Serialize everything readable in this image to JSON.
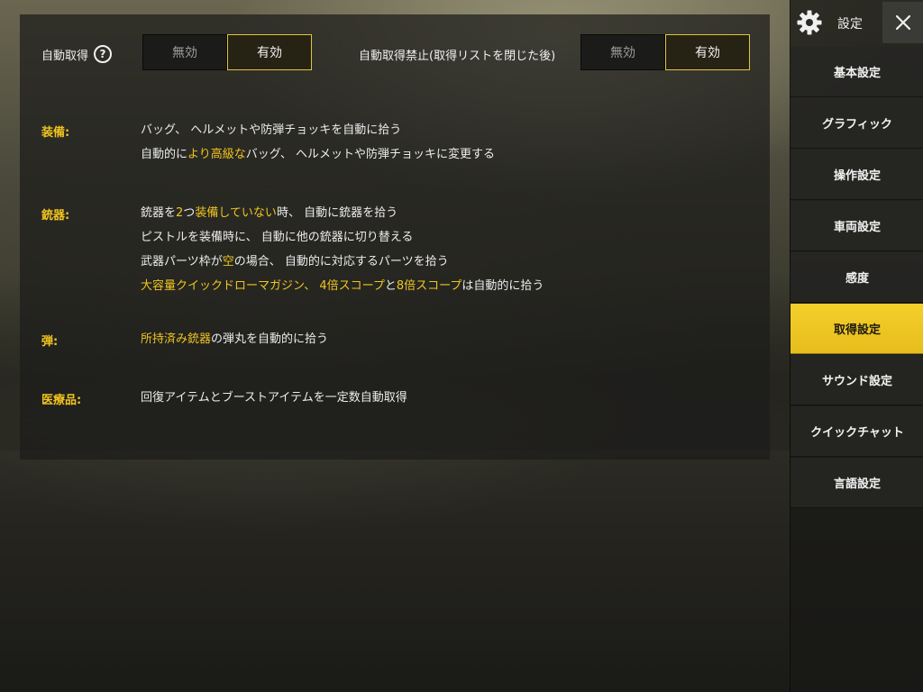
{
  "header": {
    "settings_title": "設定"
  },
  "auto_pickup": {
    "label": "自動取得",
    "off_label": "無効",
    "on_label": "有効",
    "selected": "有効"
  },
  "auto_pickup_ban": {
    "label": "自動取得禁止(取得リストを閉じた後)",
    "off_label": "無効",
    "on_label": "有効",
    "selected": "有効"
  },
  "sections": [
    {
      "head": "装備:",
      "lines": [
        [
          {
            "t": "バッグ、 ヘルメットや防弾チョッキを自動に拾う",
            "hl": false
          }
        ],
        [
          {
            "t": "自動的に",
            "hl": false
          },
          {
            "t": "より高級な",
            "hl": true
          },
          {
            "t": "バッグ、 ヘルメットや防弾チョッキに変更する",
            "hl": false
          }
        ]
      ]
    },
    {
      "head": "銃器:",
      "lines": [
        [
          {
            "t": "銃器を",
            "hl": false
          },
          {
            "t": "2",
            "hl": true
          },
          {
            "t": "つ",
            "hl": false
          },
          {
            "t": "装備していない",
            "hl": true
          },
          {
            "t": "時、 自動に銃器を拾う",
            "hl": false
          }
        ],
        [
          {
            "t": "ピストルを装備時に、 自動に他の銃器に切り替える",
            "hl": false
          }
        ],
        [
          {
            "t": "武器パーツ枠が",
            "hl": false
          },
          {
            "t": "空",
            "hl": true
          },
          {
            "t": "の場合、 自動的に対応するパーツを拾う",
            "hl": false
          }
        ],
        [
          {
            "t": "大容量クイックドローマガジン、 4倍スコープ",
            "hl": true
          },
          {
            "t": "と",
            "hl": false
          },
          {
            "t": "8倍スコープ",
            "hl": true
          },
          {
            "t": "は自動的に拾う",
            "hl": false
          }
        ]
      ]
    },
    {
      "head": "弾:",
      "lines": [
        [
          {
            "t": "所持済み銃器",
            "hl": true
          },
          {
            "t": "の弾丸を自動的に拾う",
            "hl": false
          }
        ]
      ]
    },
    {
      "head": "医療品:",
      "lines": [
        [
          {
            "t": "回復アイテムとブーストアイテムを一定数自動取得",
            "hl": false
          }
        ]
      ]
    }
  ],
  "sidebar": {
    "items": [
      {
        "label": "基本設定",
        "active": false
      },
      {
        "label": "グラフィック",
        "active": false
      },
      {
        "label": "操作設定",
        "active": false
      },
      {
        "label": "車両設定",
        "active": false
      },
      {
        "label": "感度",
        "active": false
      },
      {
        "label": "取得設定",
        "active": true
      },
      {
        "label": "サウンド設定",
        "active": false
      },
      {
        "label": "クイックチャット",
        "active": false
      },
      {
        "label": "言語設定",
        "active": false
      }
    ]
  },
  "colors": {
    "accent": "#f0c520",
    "active_tab": "#f4cf2a"
  },
  "icons": {
    "settings": "gear-icon",
    "close": "close-icon",
    "help": "help-icon"
  }
}
